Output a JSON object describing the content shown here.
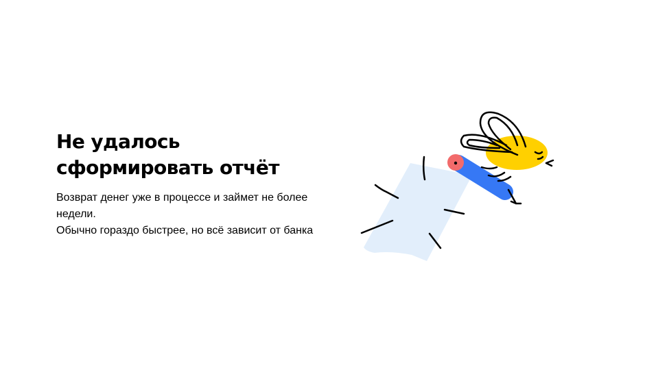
{
  "error": {
    "title_line1": "Не удалось",
    "title_line2": "сформировать отчёт",
    "description_line1": "Возврат денег уже в процессе и займет не более",
    "description_line2": "недели.",
    "description_line3": "Обычно гораздо быстрее, но всё зависит от банка"
  },
  "illustration": {
    "icon": "bee-with-pen-illustration",
    "colors": {
      "paper": "#e2eefb",
      "pen": "#3678f5",
      "pen_cap": "#f26b6b",
      "bee": "#ffd000",
      "stroke": "#000000"
    }
  }
}
